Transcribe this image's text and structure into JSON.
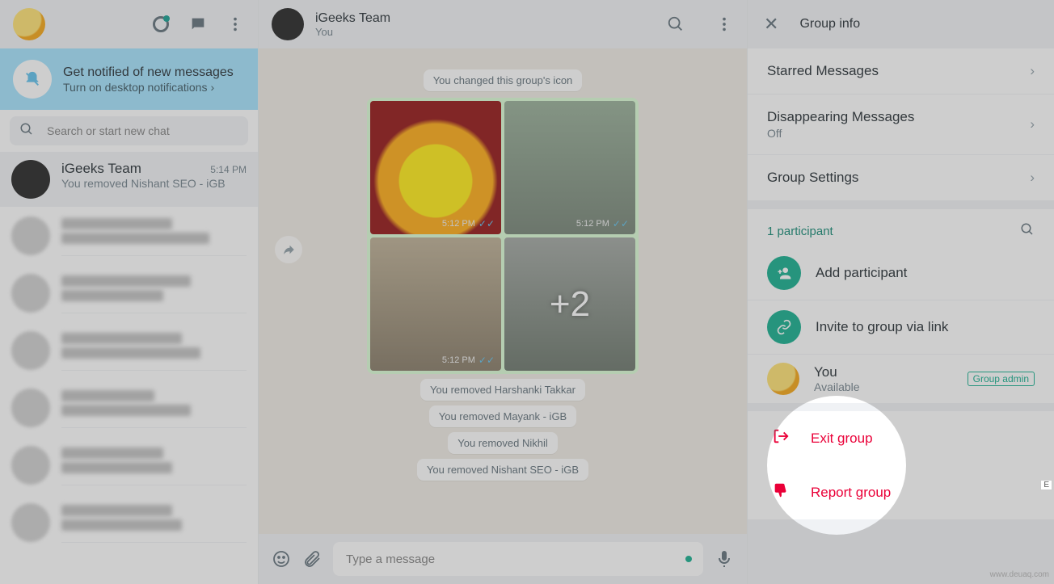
{
  "sidebar": {
    "notification": {
      "title": "Get notified of new messages",
      "link": "Turn on desktop notifications"
    },
    "search_placeholder": "Search or start new chat",
    "active_chat": {
      "name": "iGeeks Team",
      "time": "5:14 PM",
      "preview": "You removed Nishant SEO - iGB"
    }
  },
  "chat": {
    "header": {
      "title": "iGeeks Team",
      "subtitle": "You"
    },
    "system_messages": [
      "You changed this group's icon",
      "You removed Harshanki Takkar",
      "You removed Mayank - iGB",
      "You removed Nikhil",
      "You removed Nishant SEO - iGB"
    ],
    "image_timestamp": "5:12 PM",
    "image_more_count": "+2",
    "composer_placeholder": "Type a message"
  },
  "panel": {
    "title": "Group info",
    "rows": {
      "starred": "Starred Messages",
      "disappearing": "Disappearing Messages",
      "disappearing_sub": "Off",
      "settings": "Group Settings"
    },
    "participants_label": "1 participant",
    "add_participant": "Add participant",
    "invite_link": "Invite to group via link",
    "you": {
      "name": "You",
      "status": "Available",
      "badge": "Group admin"
    },
    "exit": "Exit group",
    "report": "Report group"
  },
  "watermark": "www.deuaq.com"
}
